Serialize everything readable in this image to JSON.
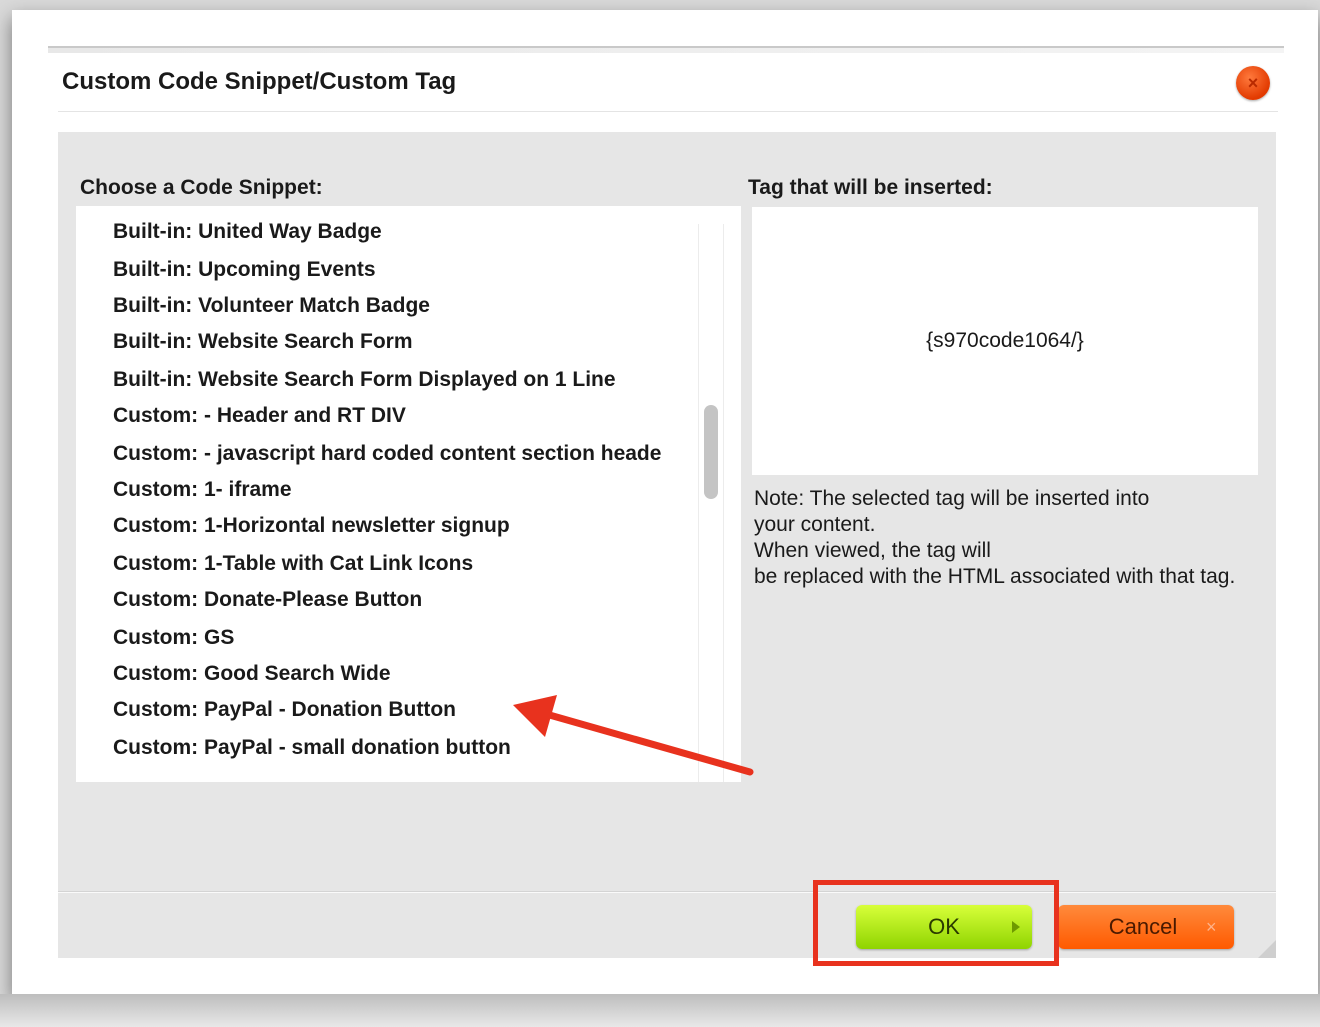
{
  "dialog": {
    "title": "Custom Code Snippet/Custom Tag",
    "close_icon": "×"
  },
  "left_panel": {
    "label": "Choose a Code Snippet:",
    "items": [
      "Built-in: United Way Badge",
      "Built-in: Upcoming Events",
      "Built-in: Volunteer Match Badge",
      "Built-in: Website Search Form",
      "Built-in: Website Search Form Displayed on 1 Line",
      "Custom: - Header and RT DIV",
      "Custom: - javascript hard coded content section heade",
      "Custom: 1- iframe",
      "Custom: 1-Horizontal newsletter signup",
      "Custom: 1-Table with Cat Link Icons",
      "Custom: Donate-Please Button",
      "Custom: GS",
      "Custom: Good Search Wide",
      "Custom: PayPal - Donation Button",
      "Custom: PayPal - small donation button"
    ]
  },
  "right_panel": {
    "label": "Tag that will be inserted:",
    "tag_value": "{s970code1064/}",
    "note_lines": [
      "Note: The selected tag will be inserted into",
      "your content.",
      "When viewed, the tag will",
      "be replaced with the HTML associated with that tag."
    ]
  },
  "footer": {
    "ok_label": "OK",
    "cancel_label": "Cancel",
    "cancel_icon": "×"
  },
  "annotation": {
    "arrow_color": "#e8321e",
    "highlight_color": "#e8321e"
  }
}
